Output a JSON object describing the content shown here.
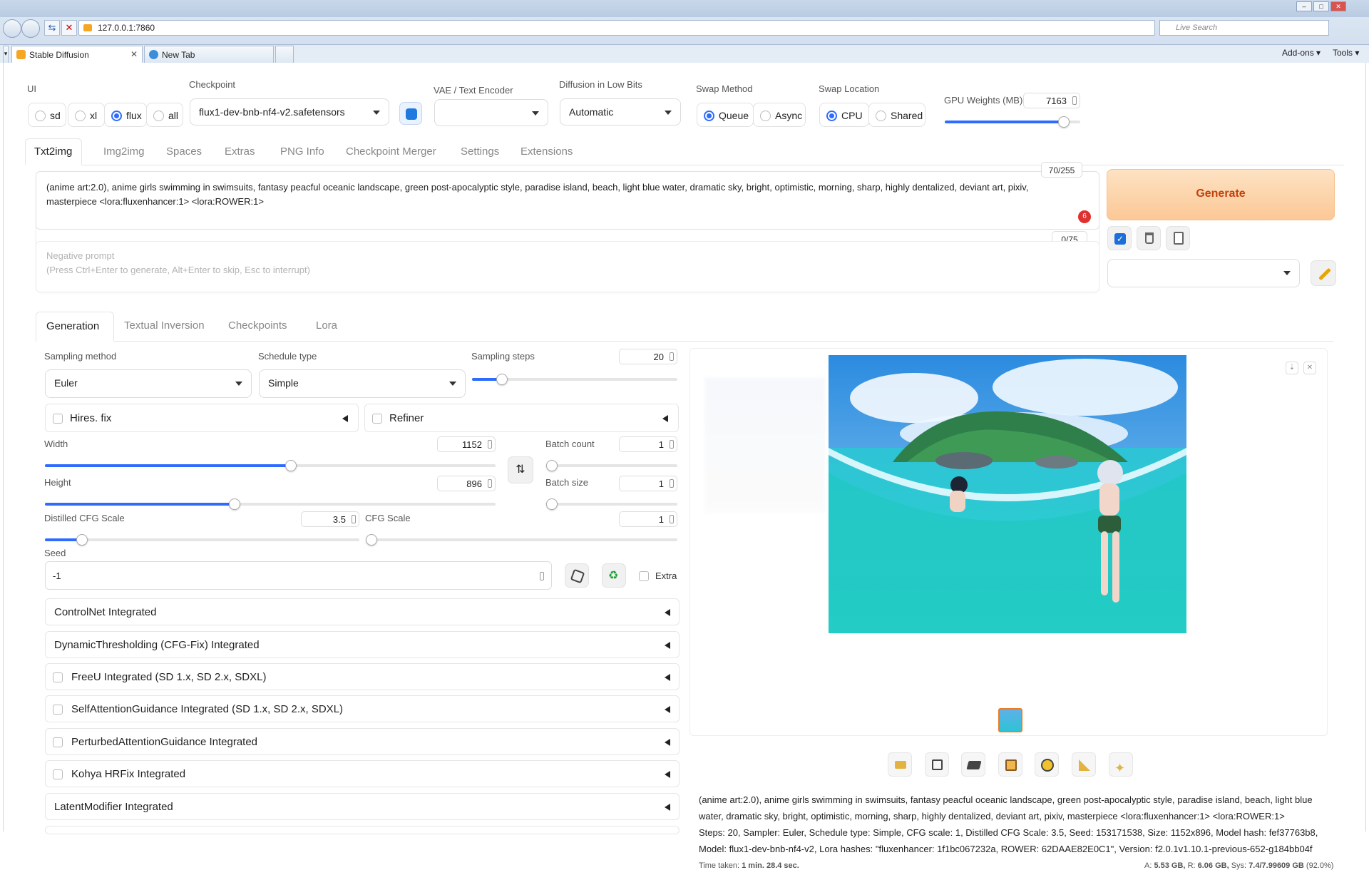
{
  "browser": {
    "url": "127.0.0.1:7860",
    "search_placeholder": "Live Search",
    "tabs": [
      {
        "label": "Stable Diffusion"
      },
      {
        "label": "New Tab"
      }
    ],
    "menu": {
      "addons": "Add-ons",
      "tools": "Tools"
    }
  },
  "top": {
    "ui_label": "UI",
    "ui_options": [
      "sd",
      "xl",
      "flux",
      "all"
    ],
    "ui_selected": "flux",
    "checkpoint_label": "Checkpoint",
    "checkpoint_value": "flux1-dev-bnb-nf4-v2.safetensors",
    "vae_label": "VAE / Text Encoder",
    "vae_value": "",
    "lowbits_label": "Diffusion in Low Bits",
    "lowbits_value": "Automatic",
    "swap_method_label": "Swap Method",
    "swap_method_options": [
      "Queue",
      "Async"
    ],
    "swap_location_label": "Swap Location",
    "swap_location_options": [
      "CPU",
      "Shared"
    ],
    "gpu_weights_label": "GPU Weights (MB)",
    "gpu_weights_value": "7163",
    "gpu_weights_fraction": 0.88
  },
  "main_tabs": [
    "Txt2img",
    "Img2img",
    "Spaces",
    "Extras",
    "PNG Info",
    "Checkpoint Merger",
    "Settings",
    "Extensions"
  ],
  "prompt": {
    "text": "(anime art:2.0), anime girls swimming in swimsuits, fantasy peacful oceanic landscape, green post-apocalyptic style, paradise island, beach, light blue water, dramatic sky, bright, optimistic, morning, sharp, highly dentalized, deviant art, pixiv, masterpiece  <lora:fluxenhancer:1>  <lora:ROWER:1>",
    "counter": "70/255",
    "badge": "6"
  },
  "negative": {
    "placeholder_line1": "Negative prompt",
    "placeholder_line2": "(Press Ctrl+Enter to generate, Alt+Enter to skip, Esc to interrupt)",
    "counter": "0/75"
  },
  "generate_label": "Generate",
  "sub_tabs": [
    "Generation",
    "Textual Inversion",
    "Checkpoints",
    "Lora"
  ],
  "gen": {
    "sampling_method_label": "Sampling method",
    "sampling_method_value": "Euler",
    "schedule_type_label": "Schedule type",
    "schedule_type_value": "Simple",
    "sampling_steps_label": "Sampling steps",
    "sampling_steps_value": "20",
    "hires_label": "Hires. fix",
    "refiner_label": "Refiner",
    "width_label": "Width",
    "width_value": "1152",
    "height_label": "Height",
    "height_value": "896",
    "batch_count_label": "Batch count",
    "batch_count_value": "1",
    "batch_size_label": "Batch size",
    "batch_size_value": "1",
    "distilled_cfg_label": "Distilled CFG Scale",
    "distilled_cfg_value": "3.5",
    "cfg_label": "CFG Scale",
    "cfg_value": "1",
    "seed_label": "Seed",
    "seed_value": "-1",
    "extra_label": "Extra"
  },
  "accordions": [
    {
      "label": "ControlNet Integrated",
      "checkbox": false
    },
    {
      "label": "DynamicThresholding (CFG-Fix) Integrated",
      "checkbox": false
    },
    {
      "label": "FreeU Integrated (SD 1.x, SD 2.x, SDXL)",
      "checkbox": true
    },
    {
      "label": "SelfAttentionGuidance Integrated (SD 1.x, SD 2.x, SDXL)",
      "checkbox": true
    },
    {
      "label": "PerturbedAttentionGuidance Integrated",
      "checkbox": true
    },
    {
      "label": "Kohya HRFix Integrated",
      "checkbox": true
    },
    {
      "label": "LatentModifier Integrated",
      "checkbox": false
    }
  ],
  "output": {
    "info_lines": [
      "(anime art:2.0), anime girls swimming in swimsuits, fantasy peacful oceanic landscape, green post-apocalyptic style, paradise island, beach, light blue",
      "water, dramatic sky, bright, optimistic, morning, sharp, highly dentalized, deviant art, pixiv, masterpiece <lora:fluxenhancer:1> <lora:ROWER:1>",
      "Steps: 20, Sampler: Euler, Schedule type: Simple, CFG scale: 1, Distilled CFG Scale: 3.5, Seed: 153171538, Size: 1152x896, Model hash: fef37763b8,",
      "Model: flux1-dev-bnb-nf4-v2, Lora hashes: \"fluxenhancer: 1f1bc067232a, ROWER: 62DAAE82E0C1\", Version: f2.0.1v1.10.1-previous-652-g184bb04f"
    ],
    "time_label": "Time taken:",
    "time_value": "1 min. 28.4 sec.",
    "mem_a_label": "A:",
    "mem_a": "5.53 GB,",
    "mem_r_label": "R:",
    "mem_r": "6.06 GB,",
    "mem_sys_label": "Sys:",
    "mem_sys": "7.4/7.99609 GB",
    "mem_pct": "(92.0%)"
  },
  "colors": {
    "accent": "#2f6bff",
    "generate_bg": "#fdd6ad",
    "generate_text": "#c2410c"
  }
}
